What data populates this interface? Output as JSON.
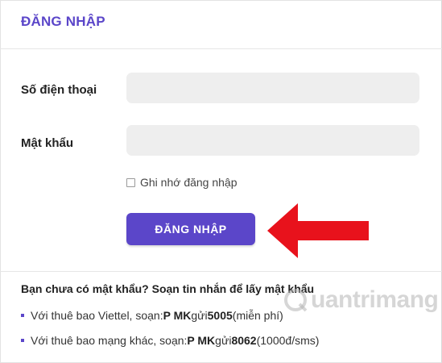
{
  "header": {
    "title": "ĐĂNG NHẬP"
  },
  "form": {
    "phone_label": "Số điện thoại",
    "phone_value": "",
    "password_label": "Mật khẩu",
    "password_value": "",
    "remember_label": "Ghi nhớ đăng nhập",
    "remember_checked": false,
    "submit_label": "ĐĂNG NHẬP"
  },
  "annotation": {
    "arrow_color": "#e8121c"
  },
  "help": {
    "prompt": "Bạn chưa có mật khẩu? Soạn tin nhắn để lấy mật khẩu",
    "items": [
      {
        "prefix": "Với thuê bao Viettel, soạn: ",
        "syntax": "P MK",
        "middle": " gửi ",
        "number": "5005",
        "suffix": " (miễn phí)"
      },
      {
        "prefix": "Với thuê bao mạng khác, soạn: ",
        "syntax": "P MK",
        "middle": " gửi ",
        "number": "8062",
        "suffix": " (1000đ/sms)"
      }
    ]
  },
  "watermark": {
    "text": "uantrimang"
  },
  "colors": {
    "accent": "#5b46c9",
    "input_bg": "#eeeeee"
  }
}
